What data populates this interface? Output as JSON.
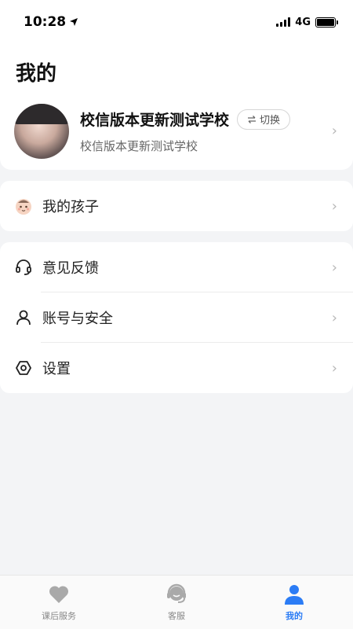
{
  "status_bar": {
    "time": "10:28",
    "network": "4G"
  },
  "page": {
    "title": "我的"
  },
  "profile": {
    "school_name": "校信版本更新测试学校",
    "switch_label": "切换",
    "subtitle": "校信版本更新测试学校"
  },
  "menu": {
    "children": "我的孩子",
    "feedback": "意见反馈",
    "account_security": "账号与安全",
    "settings": "设置"
  },
  "tabbar": {
    "tabs": [
      {
        "label": "课后服务",
        "icon": "heart-icon"
      },
      {
        "label": "客服",
        "icon": "headset-icon"
      },
      {
        "label": "我的",
        "icon": "user-icon",
        "active": true
      }
    ]
  },
  "colors": {
    "accent": "#2b7cf5",
    "background": "#f3f4f6",
    "tab_inactive": "#a9a9a9"
  }
}
